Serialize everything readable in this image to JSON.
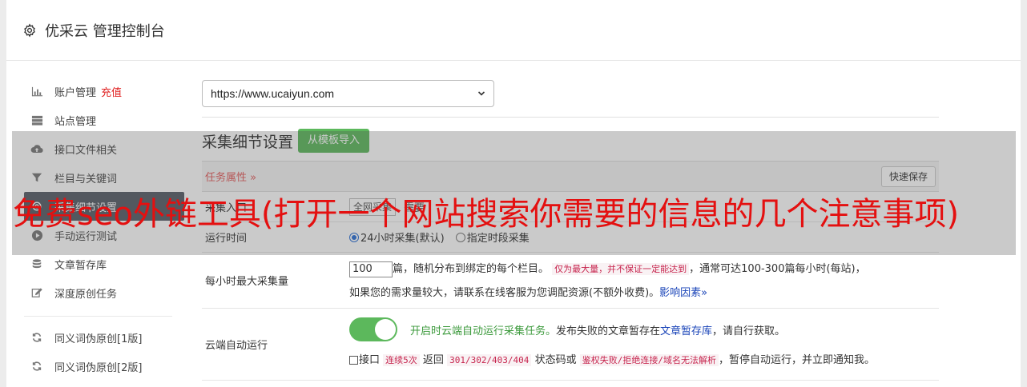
{
  "header": {
    "title": "优采云 管理控制台",
    "icon": "gear-icon"
  },
  "sidebar": {
    "items": [
      {
        "label": "账户管理",
        "extra": "充值",
        "icon": "bar-chart-icon"
      },
      {
        "label": "站点管理",
        "icon": "server-icon"
      },
      {
        "label": "接口文件相关",
        "icon": "cloud-upload-icon"
      },
      {
        "label": "栏目与关键词",
        "icon": "filter-icon"
      },
      {
        "label": "采集细节设置",
        "icon": "gear-icon",
        "active": true
      },
      {
        "label": "手动运行测试",
        "icon": "play-icon"
      },
      {
        "label": "文章暂存库",
        "icon": "database-icon"
      },
      {
        "label": "深度原创任务",
        "icon": "edit-icon"
      },
      {
        "label": "同义词伪原创[1版]",
        "icon": "refresh-icon"
      },
      {
        "label": "同义词伪原创[2版]",
        "icon": "refresh-icon"
      }
    ]
  },
  "main": {
    "site_select": "https://www.ucaiyun.com",
    "section_title": "采集细节设置",
    "import_button": "从模板导入",
    "panel": {
      "task_props": "任务属性",
      "quick_save": "快速保存",
      "entry_label": "采集入口",
      "entry_select": "全网采集",
      "entry_hint": "需要",
      "time_label": "运行时间",
      "time_opt1": "24小时采集(默认)",
      "time_opt2": "指定时段采集",
      "max_label": "每小时最大采集量",
      "max_value": "100",
      "max_text1": "篇，随机分布到绑定的每个栏目。",
      "max_code": "仅为最大量，并不保证一定能达到",
      "max_text2": "，通常可达100-300篇每小时(每站)，",
      "max_text3": "如果您的需求量较大，请联系在线客服为您调配资源(不额外收费)。",
      "max_link": "影响因素",
      "cloud_label": "云端自动运行",
      "cloud_text1": "开启时云端自动运行采集任务。",
      "cloud_text2": "发布失败的文章暂存在",
      "cloud_link": "文章暂存库",
      "cloud_text3": "，请自行获取。",
      "iface_label": "接口",
      "iface_code1": "连续5次",
      "iface_text1": "返回",
      "iface_code2": "301/302/403/404",
      "iface_text2": "状态码或",
      "iface_code3": "鉴权失败/拒绝连接/域名无法解析",
      "iface_text3": "，暂停自动运行，并立即通知我。"
    }
  },
  "overlay": {
    "text": "免费seo外链工具(打开一个网站搜索你需要的信息的几个注意事项)"
  }
}
